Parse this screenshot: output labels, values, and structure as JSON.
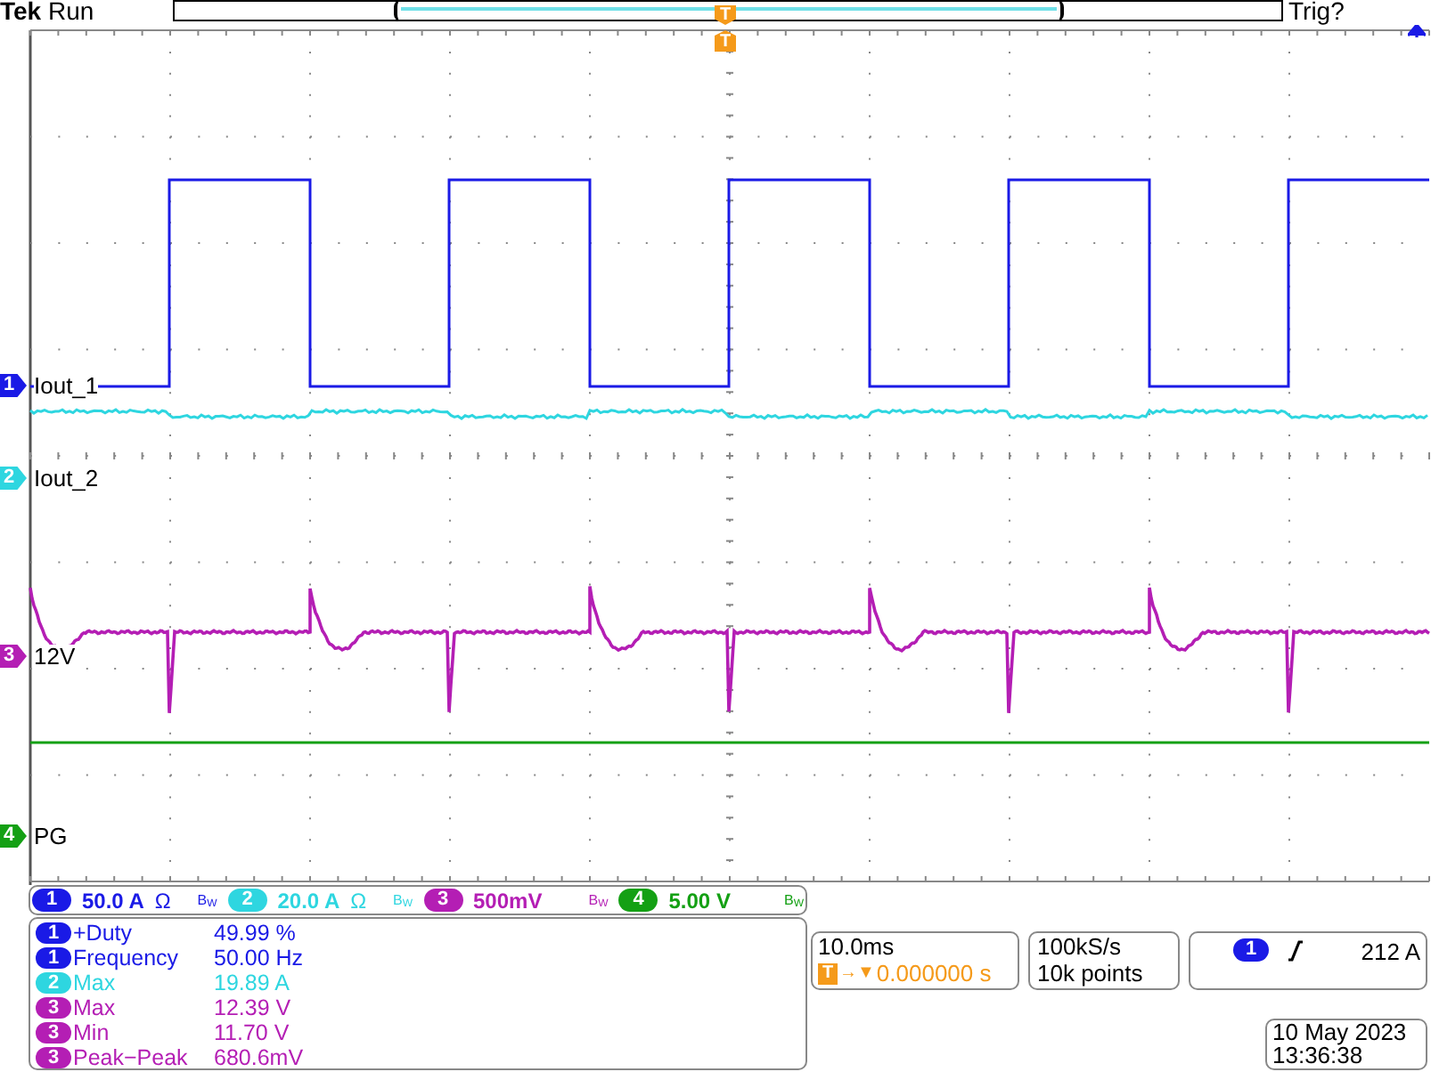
{
  "header": {
    "brand": "Tek",
    "run_state": "Run",
    "trigger_status": "Trig?",
    "trigger_marker_top": "T",
    "trigger_marker_bottom": "T"
  },
  "channels": [
    {
      "number": "1",
      "marker_number": "1",
      "label": "Iout_1",
      "color": "#1a1ae6",
      "scale": "50.0 A",
      "coupling": "Ω",
      "bw": "B$_{W}$"
    },
    {
      "number": "2",
      "marker_number": "2",
      "label": "Iout_2",
      "color": "#2ed6e0",
      "scale": "20.0 A",
      "coupling": "Ω",
      "bw": "B$_{W}$"
    },
    {
      "number": "3",
      "marker_number": "3",
      "label": "12V",
      "color": "#b41eb4",
      "scale": "500mV",
      "bw": "B$_{W}$"
    },
    {
      "number": "4",
      "marker_number": "4",
      "label": "PG",
      "color": "#14a014",
      "scale": "5.00 V",
      "bw": "B$_{W}$"
    }
  ],
  "measurements": [
    {
      "channel": "1",
      "name": "+Duty",
      "value": "49.99 %"
    },
    {
      "channel": "1",
      "name": "Frequency",
      "value": "50.00 Hz"
    },
    {
      "channel": "2",
      "name": "Max",
      "value": "19.89 A"
    },
    {
      "channel": "3",
      "name": "Max",
      "value": "12.39 V"
    },
    {
      "channel": "3",
      "name": "Min",
      "value": "11.70 V"
    },
    {
      "channel": "3",
      "name": "Peak−Peak",
      "value": "680.6mV"
    }
  ],
  "timebase": {
    "scale": "10.0ms",
    "trigger_badge": "T",
    "arrow": "→▼",
    "position": "0.000000 s"
  },
  "acquisition": {
    "sample_rate": "100kS/s",
    "record_length": "10k points"
  },
  "trigger": {
    "channel": "1",
    "kind": "rising",
    "level": "212 A"
  },
  "datetime": {
    "date": "10 May 2023",
    "time": "13:36:38"
  }
}
